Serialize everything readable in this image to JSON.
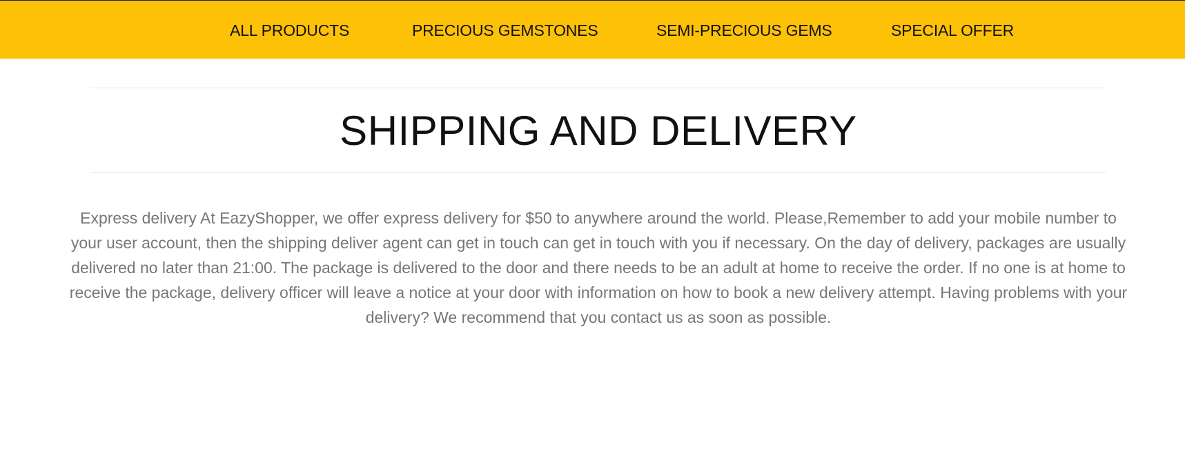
{
  "nav": {
    "items": [
      {
        "label": "ALL PRODUCTS"
      },
      {
        "label": "PRECIOUS GEMSTONES"
      },
      {
        "label": "SEMI-PRECIOUS GEMS"
      },
      {
        "label": "SPECIAL OFFER"
      }
    ]
  },
  "page": {
    "title": "SHIPPING AND DELIVERY",
    "body": "Express delivery At EazyShopper, we offer express delivery for $50 to anywhere around the world. Please,Remember to add your mobile number to your user account, then the shipping deliver agent can get in touch can get in touch with you if necessary. On the day of delivery, packages are usually delivered no later than 21:00. The package is delivered to the door and there needs to be an adult at home to receive the order. If no one is at home to receive the package, delivery officer will leave a notice at your door with information on how to book a new delivery attempt. Having problems with your delivery? We recommend that you contact us as soon as possible."
  },
  "colors": {
    "nav_background": "#fdc107",
    "nav_text": "#111111",
    "title_text": "#111111",
    "body_text": "#777777",
    "divider": "#e3e3e3"
  }
}
